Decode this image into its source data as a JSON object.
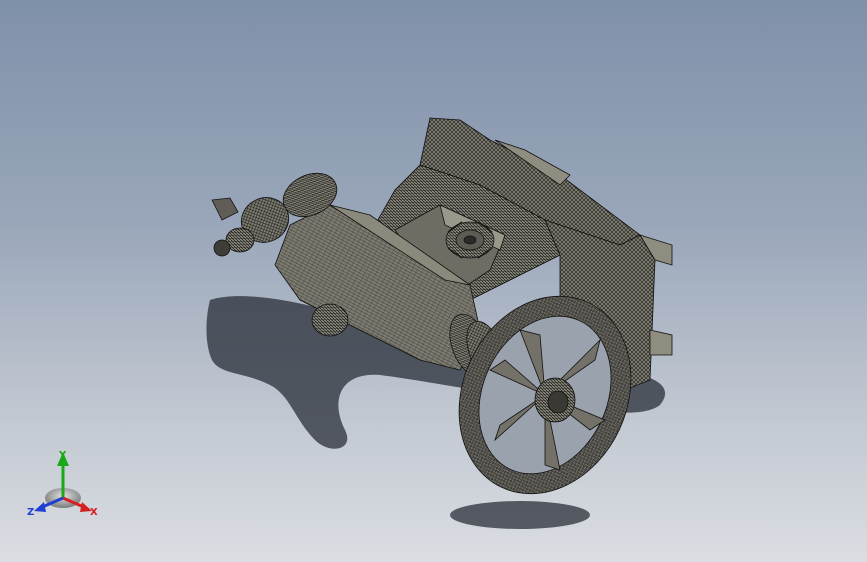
{
  "view": {
    "mode": "wireframe-shaded",
    "model": "cannon-with-wheel",
    "background_top": "#7f90a9",
    "background_bottom": "#dadde2",
    "mesh_color": "#7e7c72",
    "edge_color": "#1a1a1a"
  },
  "triad": {
    "x_label": "X",
    "y_label": "Y",
    "z_label": "Z",
    "x_color": "#d42020",
    "y_color": "#18a818",
    "z_color": "#1f3fd0"
  }
}
